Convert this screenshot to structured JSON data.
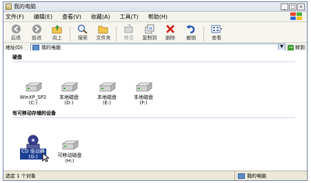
{
  "window": {
    "title": "我的电脑"
  },
  "menu": [
    "文件(F)",
    "编辑(E)",
    "查看(V)",
    "收藏(A)",
    "工具(T)",
    "帮助(H)"
  ],
  "toolbar": {
    "back": "后退",
    "forward": "前进",
    "up": "向上",
    "search": "搜索",
    "folders": "文件夹",
    "move": "移至",
    "copy": "复制到",
    "delete": "删除",
    "undo": "撤销",
    "views": "查看"
  },
  "address": {
    "label": "地址(D)",
    "value": "我的电脑",
    "go": "转到"
  },
  "sections": {
    "hard_disks": "硬盘",
    "removable": "有可移动存储的设备"
  },
  "drives": [
    {
      "name": "WinXP_SP2",
      "letter": "(C:)"
    },
    {
      "name": "本地磁盘",
      "letter": "(D:)"
    },
    {
      "name": "本地磁盘",
      "letter": "(E:)"
    },
    {
      "name": "本地磁盘",
      "letter": "(F:)"
    }
  ],
  "removable": [
    {
      "name": "CD 驱动器",
      "letter": "(G:)",
      "selected": true
    },
    {
      "name": "可移动磁盘",
      "letter": "(H:)",
      "selected": false
    }
  ],
  "status": {
    "left": "选定 1 个对象",
    "right": "我的电脑"
  }
}
